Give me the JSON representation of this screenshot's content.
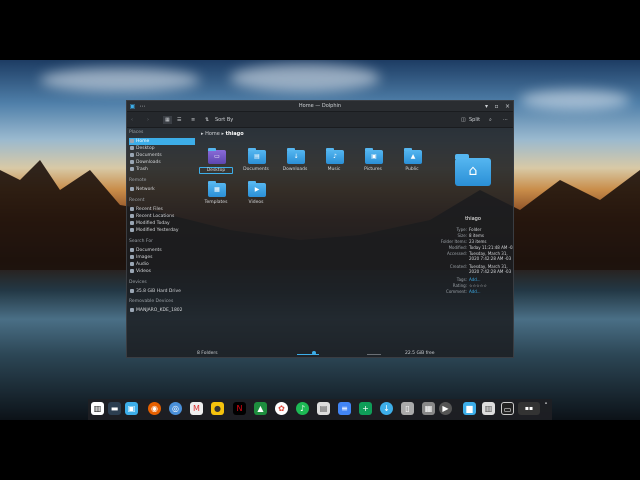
{
  "window": {
    "title": "Home — Dolphin",
    "toolbar": {
      "sort_label": "Sort By",
      "split_label": "Split"
    },
    "breadcrumb": {
      "root": "Home",
      "current": "thiago"
    }
  },
  "sidebar": {
    "sections": [
      {
        "title": "Places",
        "items": [
          "Home",
          "Desktop",
          "Documents",
          "Downloads",
          "Trash"
        ]
      },
      {
        "title": "Remote",
        "items": [
          "Network"
        ]
      },
      {
        "title": "Recent",
        "items": [
          "Recent Files",
          "Recent Locations",
          "Modified Today",
          "Modified Yesterday"
        ]
      },
      {
        "title": "Search For",
        "items": [
          "Documents",
          "Images",
          "Audio",
          "Videos"
        ]
      },
      {
        "title": "Devices",
        "items": [
          "35.8 GiB Hard Drive"
        ]
      },
      {
        "title": "Removable Devices",
        "items": [
          "MANJARO_KDE_1802"
        ]
      }
    ]
  },
  "folders": [
    {
      "label": "Desktop",
      "glyph": "▭",
      "selected": true
    },
    {
      "label": "Documents",
      "glyph": "▤"
    },
    {
      "label": "Downloads",
      "glyph": "↓"
    },
    {
      "label": "Music",
      "glyph": "♪"
    },
    {
      "label": "Pictures",
      "glyph": "▣"
    },
    {
      "label": "Public",
      "glyph": "▲"
    },
    {
      "label": "Templates",
      "glyph": "▦"
    },
    {
      "label": "Videos",
      "glyph": "▶"
    }
  ],
  "info_panel": {
    "name": "thiago",
    "rows": [
      {
        "k": "Type:",
        "v": "Folder"
      },
      {
        "k": "Size:",
        "v": "8 items"
      },
      {
        "k": "Folder Items:",
        "v": "23 items"
      },
      {
        "k": "Modified:",
        "v": "Today 11:21:48 AM -03"
      },
      {
        "k": "Accessed:",
        "v": "Tuesday, March 31,"
      },
      {
        "k": "",
        "v": "2020 7:42:28 AM -03"
      },
      {
        "k": "Created:",
        "v": "Tuesday, March 31,"
      },
      {
        "k": "",
        "v": "2020 7:42:28 AM -03"
      },
      {
        "k": "Tags:",
        "v": "Add..."
      },
      {
        "k": "Rating:",
        "v": "☆☆☆☆☆"
      },
      {
        "k": "Comment:",
        "v": "Add..."
      }
    ]
  },
  "status": {
    "left": "8 Folders",
    "right": "22.5 GiB free"
  },
  "dock_icons": [
    "manjaro-icon",
    "desktop-icon",
    "dolphin-icon",
    "firefox-icon",
    "chromium-icon",
    "gmail-icon",
    "keep-icon",
    "netflix-icon",
    "drive-icon",
    "photos-icon",
    "music-icon",
    "files-icon",
    "docs-icon",
    "sheets-icon",
    "download-icon",
    "book-icon",
    "calculator-icon",
    "player-icon",
    "folder-icon",
    "trash-icon",
    "screen-icon",
    "tray-icon"
  ],
  "colors": {
    "accent": "#3daee9",
    "window_bg": "#1c1e22"
  }
}
